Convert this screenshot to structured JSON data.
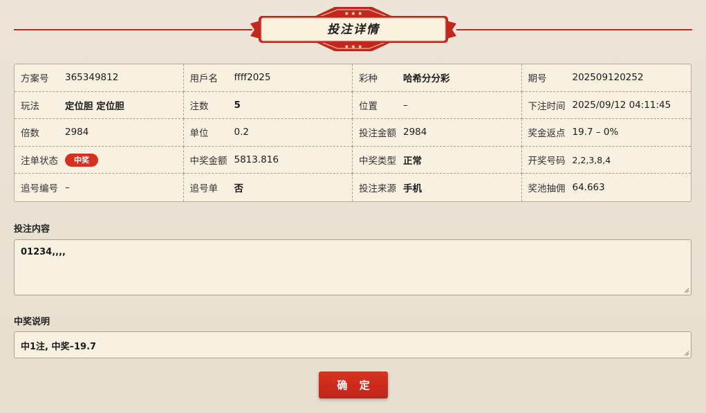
{
  "header": {
    "title": "投注详情"
  },
  "details": [
    [
      {
        "label": "方案号",
        "value": "365349812"
      },
      {
        "label": "用戶名",
        "value": "ffff2025"
      },
      {
        "label": "彩种",
        "value": "哈希分分彩"
      },
      {
        "label": "期号",
        "value": "202509120252"
      }
    ],
    [
      {
        "label": "玩法",
        "value": "定位胆 定位胆"
      },
      {
        "label": "注数",
        "value": "5"
      },
      {
        "label": "位置",
        "value": "–"
      },
      {
        "label": "下注时间",
        "value": "2025/09/12 04:11:45"
      }
    ],
    [
      {
        "label": "倍数",
        "value": "2984"
      },
      {
        "label": "单位",
        "value": "0.2"
      },
      {
        "label": "投注金额",
        "value": "2984"
      },
      {
        "label": "奖金返点",
        "value": "19.7 – 0%"
      }
    ],
    [
      {
        "label": "注单状态",
        "value": "中奖"
      },
      {
        "label": "中奖金额",
        "value": "5813.816"
      },
      {
        "label": "中奖类型",
        "value": "正常"
      },
      {
        "label": "开奖号码",
        "value": "2,2,3,8,4"
      }
    ],
    [
      {
        "label": "追号编号",
        "value": "–"
      },
      {
        "label": "追号单",
        "value": "否"
      },
      {
        "label": "投注来源",
        "value": "手机"
      },
      {
        "label": "奖池抽佣",
        "value": "64.663"
      }
    ]
  ],
  "bet_content": {
    "label": "投注内容",
    "value": "01234,,,,"
  },
  "win_desc": {
    "label": "中奖说明",
    "value": "中1注, 中奖–19.7"
  },
  "confirm_label": "确 定",
  "colors": {
    "accent": "#c0281f",
    "panel": "#f8f1e2",
    "background": "#e8e0d2"
  }
}
